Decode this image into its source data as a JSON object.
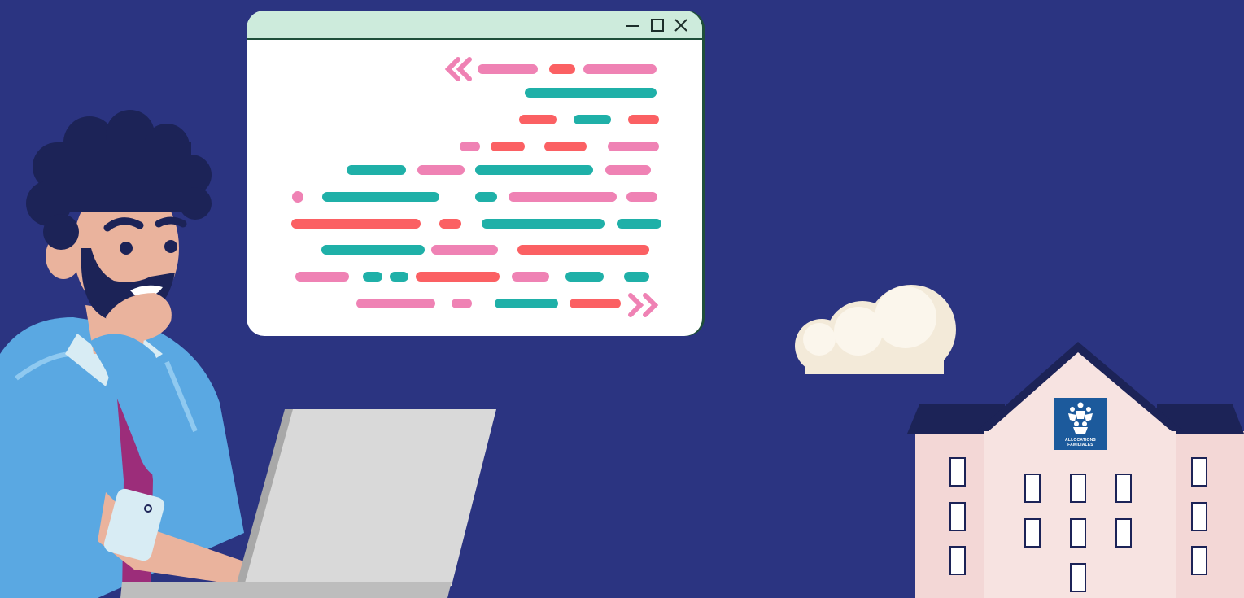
{
  "window": {
    "minimize_icon": "minimize-icon",
    "maximize_icon": "maximize-icon",
    "close_icon": "close-icon"
  },
  "logo": {
    "line1": "ALLOCATIONS",
    "line2": "FAMILIALES"
  },
  "colors": {
    "background": "#2b3481",
    "window_titlebar": "#cdebdc",
    "code_teal": "#1fb0a8",
    "code_pink": "#ef82b4",
    "code_coral": "#fb6063",
    "building": "#f7dfdd",
    "roof": "#1c2357",
    "logo": "#1c5a9c"
  }
}
